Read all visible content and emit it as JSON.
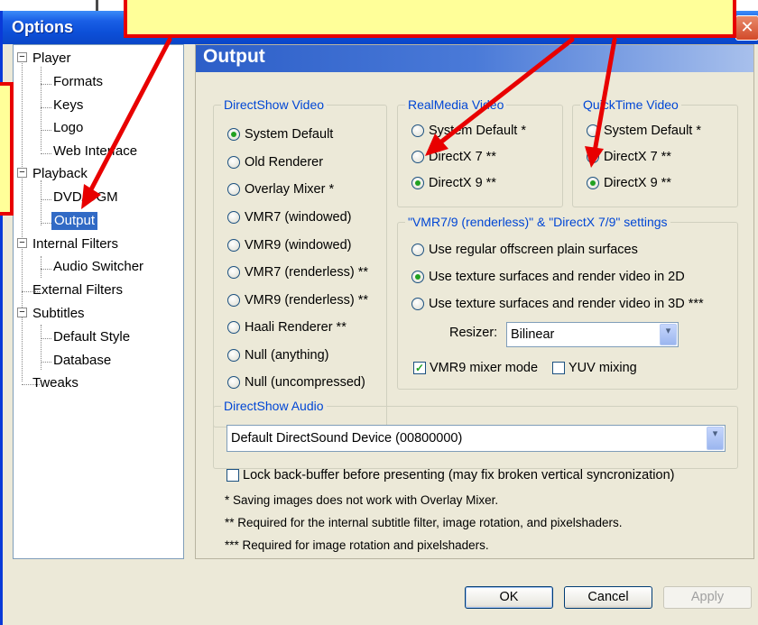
{
  "window": {
    "title": "Options",
    "close_glyph": "✕"
  },
  "tree": {
    "items": [
      {
        "label": "Player",
        "toggle": "−"
      },
      {
        "label": "Formats"
      },
      {
        "label": "Keys"
      },
      {
        "label": "Logo"
      },
      {
        "label": "Web Interface"
      },
      {
        "label": "Playback",
        "toggle": "−"
      },
      {
        "label": "DVD/OGM"
      },
      {
        "label": "Output",
        "selected": true
      },
      {
        "label": "Internal Filters",
        "toggle": "−"
      },
      {
        "label": "Audio Switcher"
      },
      {
        "label": "External Filters"
      },
      {
        "label": "Subtitles",
        "toggle": "−"
      },
      {
        "label": "Default Style"
      },
      {
        "label": "Database"
      },
      {
        "label": "Tweaks"
      }
    ]
  },
  "panel": {
    "title": "Output",
    "directshow_video": {
      "title": "DirectShow Video",
      "options": [
        {
          "label": "System Default",
          "checked": true
        },
        {
          "label": "Old Renderer",
          "checked": false
        },
        {
          "label": "Overlay Mixer *",
          "checked": false
        },
        {
          "label": "VMR7 (windowed)",
          "checked": false
        },
        {
          "label": "VMR9 (windowed)",
          "checked": false
        },
        {
          "label": "VMR7 (renderless) **",
          "checked": false
        },
        {
          "label": "VMR9 (renderless) **",
          "checked": false
        },
        {
          "label": "Haali Renderer **",
          "checked": false
        },
        {
          "label": "Null (anything)",
          "checked": false
        },
        {
          "label": "Null (uncompressed)",
          "checked": false
        }
      ]
    },
    "realmedia_video": {
      "title": "RealMedia Video",
      "options": [
        {
          "label": "System Default *",
          "checked": false
        },
        {
          "label": "DirectX 7 **",
          "checked": false
        },
        {
          "label": "DirectX 9 **",
          "checked": true
        }
      ]
    },
    "quicktime_video": {
      "title": "QuickTime Video",
      "options": [
        {
          "label": "System Default *",
          "checked": false
        },
        {
          "label": "DirectX 7 **",
          "checked": false
        },
        {
          "label": "DirectX 9 **",
          "checked": true
        }
      ]
    },
    "vmr_settings": {
      "title": "\"VMR7/9 (renderless)\" & \"DirectX 7/9\" settings",
      "options": [
        {
          "label": "Use regular offscreen plain surfaces",
          "checked": false
        },
        {
          "label": "Use texture surfaces and render video in 2D",
          "checked": true
        },
        {
          "label": "Use texture surfaces and render video in 3D ***",
          "checked": false
        }
      ],
      "resizer_label": "Resizer:",
      "resizer_value": "Bilinear",
      "vmr9_mixer_label": "VMR9 mixer mode",
      "vmr9_mixer_checked": true,
      "yuv_mixing_label": "YUV mixing",
      "yuv_mixing_checked": false
    },
    "directshow_audio": {
      "title": "DirectShow Audio",
      "device": "Default DirectSound Device (00800000)"
    },
    "lock_backbuffer_label": "Lock back-buffer before presenting (may fix broken vertical syncronization)",
    "lock_backbuffer_checked": false,
    "notes": [
      "* Saving images does not work with Overlay Mixer.",
      "** Required for the internal subtitle filter, image rotation, and pixelshaders.",
      "*** Required for image rotation and pixelshaders."
    ]
  },
  "buttons": {
    "ok": "OK",
    "cancel": "Cancel",
    "apply": "Apply"
  },
  "icons": {
    "dropdown": "▾",
    "check": "✓"
  },
  "colors": {
    "annotation_red": "#e80000",
    "annotation_fill": "#ffff99",
    "titlebar_blue": "#0c4fd8",
    "selection_blue": "#316ac5",
    "group_title_blue": "#0046d5"
  }
}
